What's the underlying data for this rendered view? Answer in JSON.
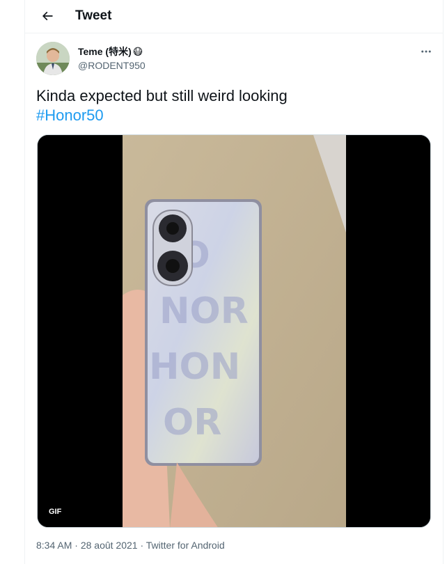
{
  "header": {
    "title": "Tweet"
  },
  "author": {
    "display_name": "Teme (特米)",
    "emoji": "😷",
    "handle": "@RODENT950"
  },
  "tweet": {
    "text": "Kinda expected but still weird looking",
    "hashtag": "#Honor50"
  },
  "media": {
    "badge": "GIF"
  },
  "meta": {
    "time": "8:34 AM",
    "separator1": " · ",
    "date": "28 août 2021",
    "separator2": " · ",
    "source": "Twitter for Android"
  },
  "colors": {
    "accent": "#1d9bf0",
    "secondary_text": "#536471",
    "primary_text": "#0f1419"
  },
  "icons": {
    "back": "arrow-left-icon",
    "more": "more-horizontal-icon"
  }
}
